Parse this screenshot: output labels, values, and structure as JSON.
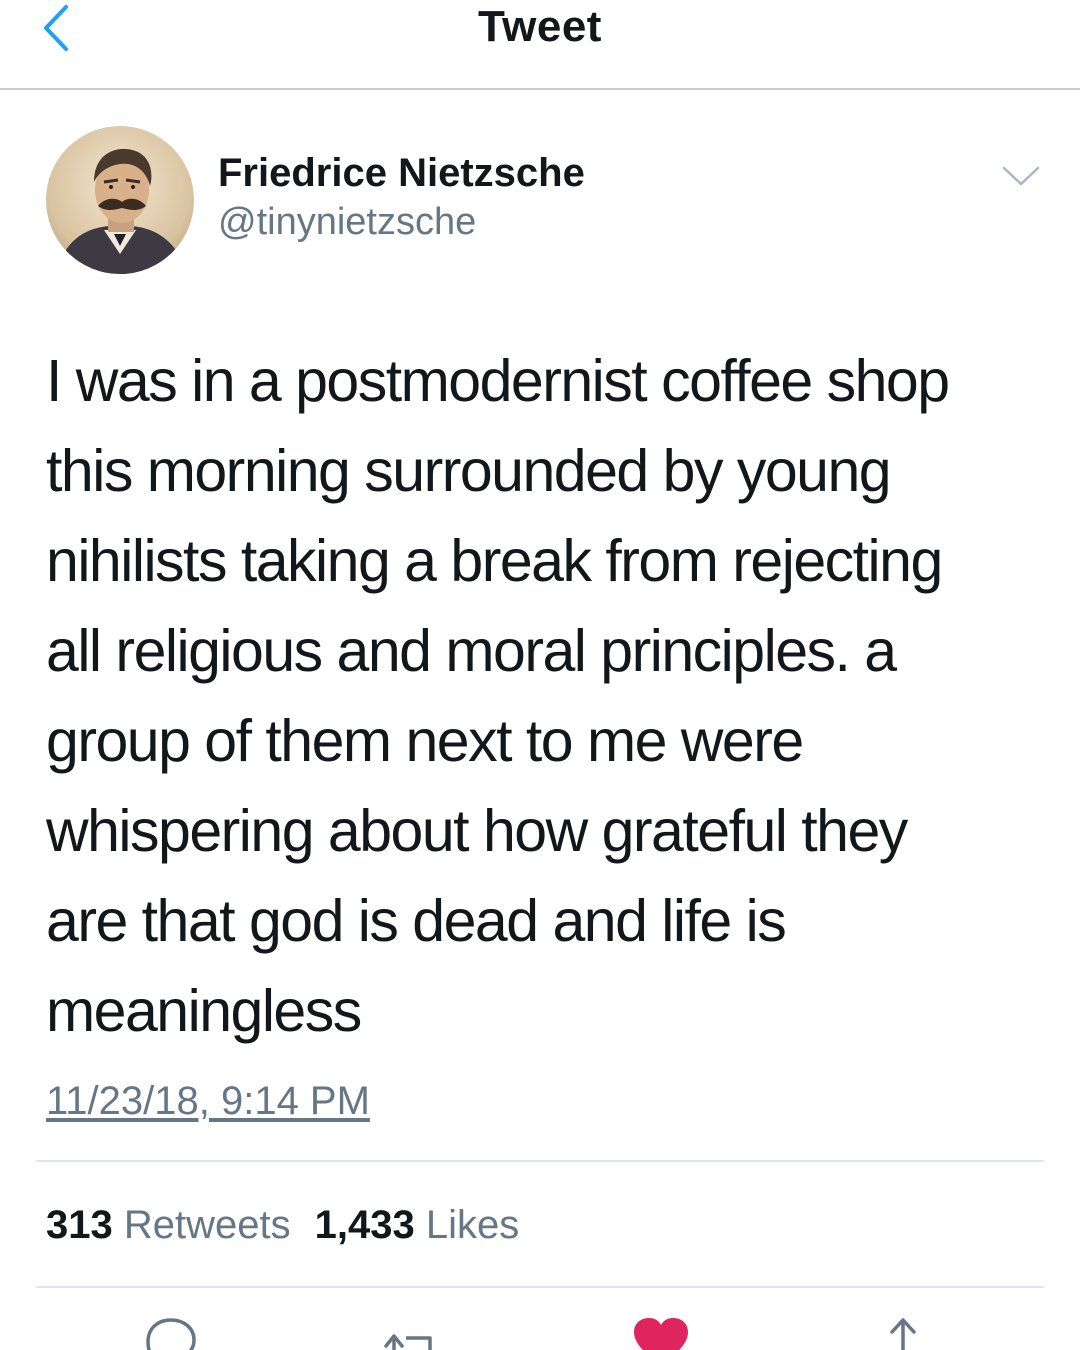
{
  "header": {
    "title": "Tweet"
  },
  "author": {
    "name": "Friedrice Nietzsche",
    "handle": "@tinynietzsche"
  },
  "tweet": {
    "text": "I was in a postmodernist coffee shop\nthis morning surrounded by young\nnihilists taking a break from rejecting\nall religious and moral principles. a\ngroup of them next to me were\nwhispering about how grateful they\nare that god is dead and life is\nmeaningless",
    "timestamp": "11/23/18, 9:14 PM"
  },
  "stats": {
    "retweets_count": "313",
    "retweets_label": "Retweets",
    "likes_count": "1,433",
    "likes_label": "Likes"
  },
  "icons": {
    "back": "chevron-left-icon",
    "menu": "chevron-down-icon",
    "reply": "reply-icon",
    "retweet": "retweet-icon",
    "like": "heart-icon",
    "share": "share-icon"
  },
  "colors": {
    "accent": "#1da1f2",
    "like": "#e0245e",
    "secondary_text": "#657786",
    "divider": "#e1e8ed"
  }
}
